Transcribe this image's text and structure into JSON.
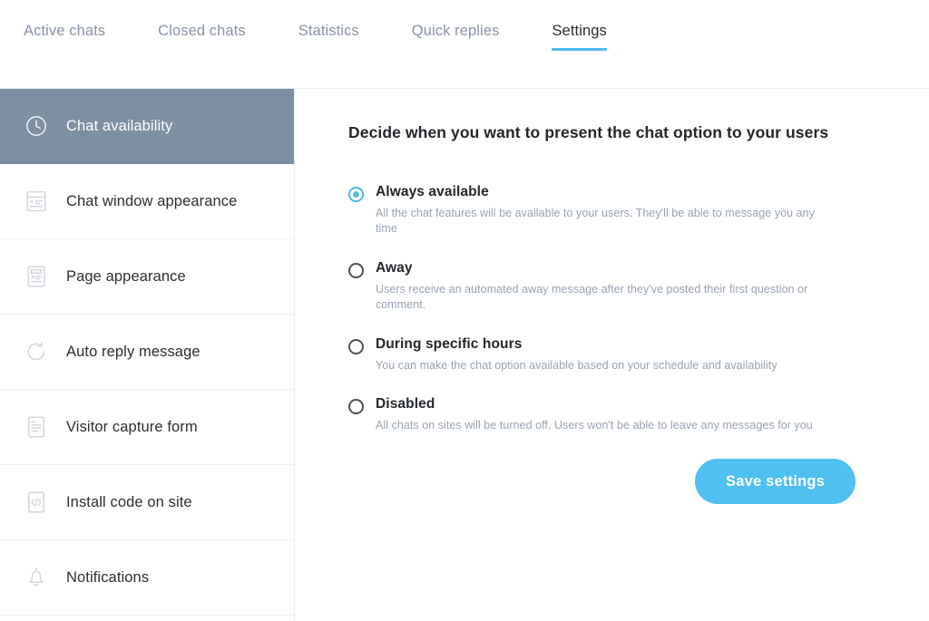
{
  "tabs": [
    {
      "label": "Active chats",
      "active": false
    },
    {
      "label": "Closed chats",
      "active": false
    },
    {
      "label": "Statistics",
      "active": false
    },
    {
      "label": "Quick replies",
      "active": false
    },
    {
      "label": "Settings",
      "active": true
    }
  ],
  "sidebar": {
    "items": [
      {
        "label": "Chat availability",
        "icon": "clock-icon",
        "active": true
      },
      {
        "label": "Chat window appearance",
        "icon": "chat-window-icon",
        "active": false
      },
      {
        "label": "Page appearance",
        "icon": "page-document-icon",
        "active": false
      },
      {
        "label": "Auto reply message",
        "icon": "refresh-arrow-icon",
        "active": false
      },
      {
        "label": "Visitor capture form",
        "icon": "form-document-icon",
        "active": false
      },
      {
        "label": "Install code on site",
        "icon": "code-brackets-icon",
        "active": false
      },
      {
        "label": "Notifications",
        "icon": "bell-icon",
        "active": false
      }
    ]
  },
  "main": {
    "heading": "Decide when you want to present the chat option to your users",
    "options": [
      {
        "label": "Always available",
        "description": "All the chat features will be available to your users. They'll be able to message you any time",
        "selected": true
      },
      {
        "label": "Away",
        "description": "Users receive an automated away message after they've posted their first question or comment.",
        "selected": false
      },
      {
        "label": "During specific hours",
        "description": "You can make the chat option available based on your schedule and availability",
        "selected": false
      },
      {
        "label": "Disabled",
        "description": "All chats on sites will be turned off. Users won't be able to leave any messages for you",
        "selected": false
      }
    ],
    "save_label": "Save settings"
  },
  "colors": {
    "accent_blue": "#4fb8ec",
    "button_blue": "#4fc0f0",
    "sidebar_active": "#7d8fa3",
    "muted_text": "#98a4b3",
    "tab_inactive": "#8894a5"
  }
}
